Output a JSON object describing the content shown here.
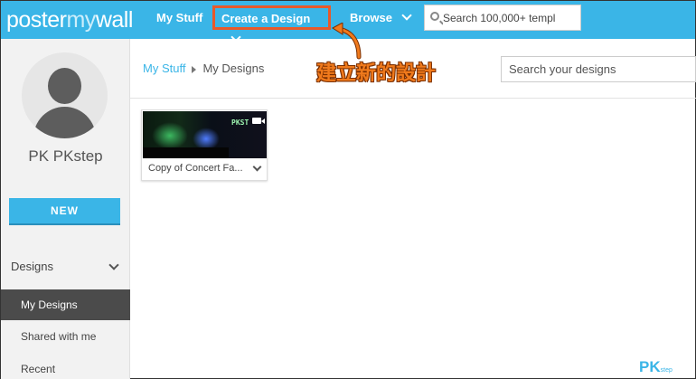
{
  "nav": {
    "logo_primary": "poster",
    "logo_secondary": "my",
    "logo_tertiary": "wall",
    "my_stuff": "My Stuff",
    "create_design": "Create a Design",
    "browse": "Browse",
    "search_placeholder": "Search 100,000+ templ"
  },
  "sidebar": {
    "username": "PK PKstep",
    "new_button": "NEW",
    "section_label": "Designs",
    "items": [
      {
        "label": "My Designs",
        "active": true
      },
      {
        "label": "Shared with me",
        "active": false
      },
      {
        "label": "Recent",
        "active": false
      }
    ]
  },
  "main": {
    "breadcrumb": [
      "My Stuff",
      "My Designs"
    ],
    "search_placeholder": "Search your designs",
    "annotation": "建立新的設計",
    "designs": [
      {
        "title": "Copy of Concert Fa...",
        "thumb_text": "PKST"
      }
    ]
  },
  "watermark": {
    "main": "PK",
    "sub": "step"
  },
  "colors": {
    "brand": "#3ab5e7",
    "highlight": "#e8592a",
    "annotation": "#f07a1c"
  }
}
